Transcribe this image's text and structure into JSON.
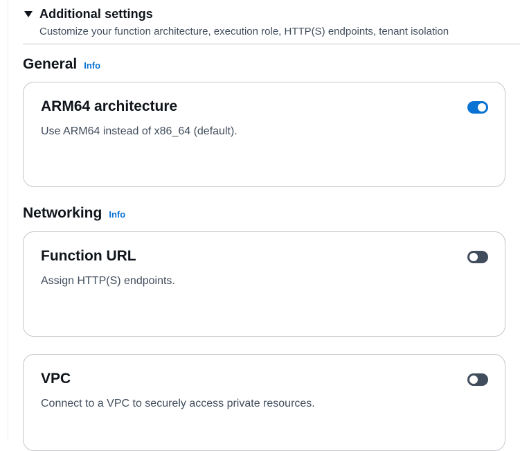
{
  "section": {
    "title": "Additional settings",
    "description": "Customize your function architecture, execution role, HTTP(S) endpoints, tenant isolation"
  },
  "general": {
    "heading": "General",
    "info": "Info",
    "cards": [
      {
        "title": "ARM64 architecture",
        "description": "Use ARM64 instead of x86_64 (default).",
        "enabled": true
      }
    ]
  },
  "networking": {
    "heading": "Networking",
    "info": "Info",
    "cards": [
      {
        "title": "Function URL",
        "description": "Assign HTTP(S) endpoints.",
        "enabled": false
      },
      {
        "title": "VPC",
        "description": "Connect to a VPC to securely access private resources.",
        "enabled": false
      }
    ]
  },
  "colors": {
    "toggle_on": "#0972d3",
    "toggle_off": "#414d5c",
    "info_link": "#0972d3",
    "card_border": "#c6c6cd"
  }
}
